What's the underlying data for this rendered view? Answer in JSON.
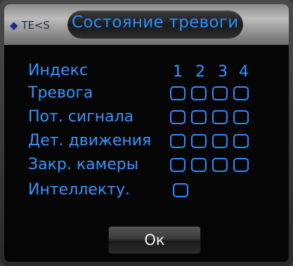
{
  "dialog": {
    "logo_text": "TE<S",
    "title": "Состояние тревоги",
    "ok_label": "Ок"
  },
  "columns": [
    "1",
    "2",
    "3",
    "4"
  ],
  "rows": [
    {
      "label": "Индекс"
    },
    {
      "label": "Тревога"
    },
    {
      "label": "Пот. сигнала"
    },
    {
      "label": "Дет. движения"
    },
    {
      "label": "Закр. камеры"
    },
    {
      "label": "Интеллекту."
    }
  ],
  "colors": {
    "accent": "#3796ff",
    "background": "#050505"
  }
}
